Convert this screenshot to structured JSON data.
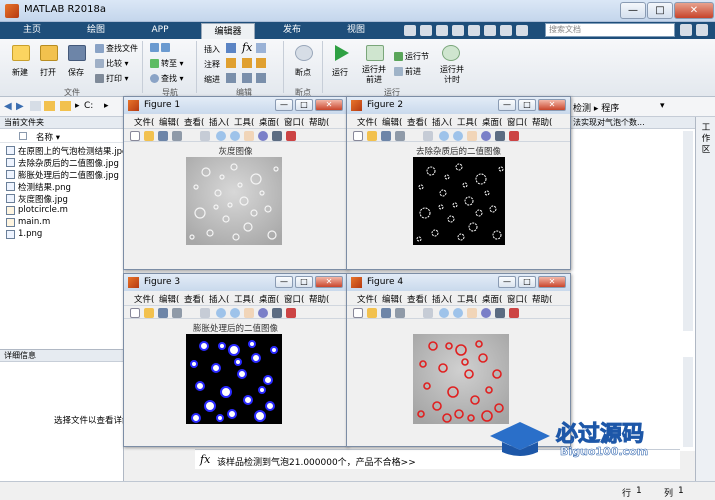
{
  "app": {
    "title": "MATLAB R2018a",
    "win_min": "—",
    "win_max": "□",
    "win_close": "✕"
  },
  "tabs": [
    "主页",
    "绘图",
    "APP",
    "编辑器",
    "发布",
    "视图"
  ],
  "search": {
    "placeholder": "搜索文档"
  },
  "ribbon": {
    "new": "新建",
    "open": "打开",
    "save": "保存",
    "find_files": "查找文件",
    "compare": "比较",
    "print": "打印",
    "group_file": "文件",
    "goto": "转至",
    "find": "查找",
    "group_nav": "导航",
    "insert": "插入",
    "comment": "注释",
    "indent": "缩进",
    "group_edit": "编辑",
    "breakpoint": "断点",
    "group_bp": "断点",
    "run": "运行",
    "run_advance": "运行并\n前进",
    "run_section": "运行节",
    "advance": "前进",
    "run_time": "运行并\n计时",
    "group_run": "运行"
  },
  "address": {
    "path": "C:"
  },
  "current_folder": {
    "header": "当前文件夹",
    "col_name": "名称 ▾",
    "files": [
      "在原图上的气泡检测结果.jpg",
      "去除杂质后的二值图像.jpg",
      "膨胀处理后的二值图像.jpg",
      "检测结果.png",
      "灰度图像.jpg",
      "plotcircle.m",
      "main.m",
      "1.png"
    ]
  },
  "details": {
    "header": "详细信息",
    "hint": "选择文件以查看详细信息"
  },
  "right": {
    "breadcrumb": "检测 ▸ 程序",
    "snippet": "法实现对气泡个数...",
    "vtab": "工作区"
  },
  "figures": [
    {
      "title": "Figure 1",
      "plot_title": "灰度图像"
    },
    {
      "title": "Figure 2",
      "plot_title": "去除杂质后的二值图像"
    },
    {
      "title": "Figure 3",
      "plot_title": "膨胀处理后的二值图像"
    },
    {
      "title": "Figure 4",
      "plot_title": ""
    }
  ],
  "fig_menu": [
    "文件(",
    "编辑(",
    "查看(",
    "插入(",
    "工具(",
    "桌面(",
    "窗口(",
    "帮助("
  ],
  "command": {
    "prompt": "fx",
    "text": "该样品检测到气泡21.000000个，产品不合格>>"
  },
  "status": {
    "row_label": "行",
    "row": "1",
    "col_label": "列",
    "col": "1"
  },
  "watermark": {
    "cn": "必过源码",
    "url": "Biguo100.com"
  },
  "colors": {
    "tabbar": "#1e4e7a",
    "circle_blue": "#2a2aff",
    "circle_red": "#e02020",
    "run_green": "#2ea043"
  }
}
